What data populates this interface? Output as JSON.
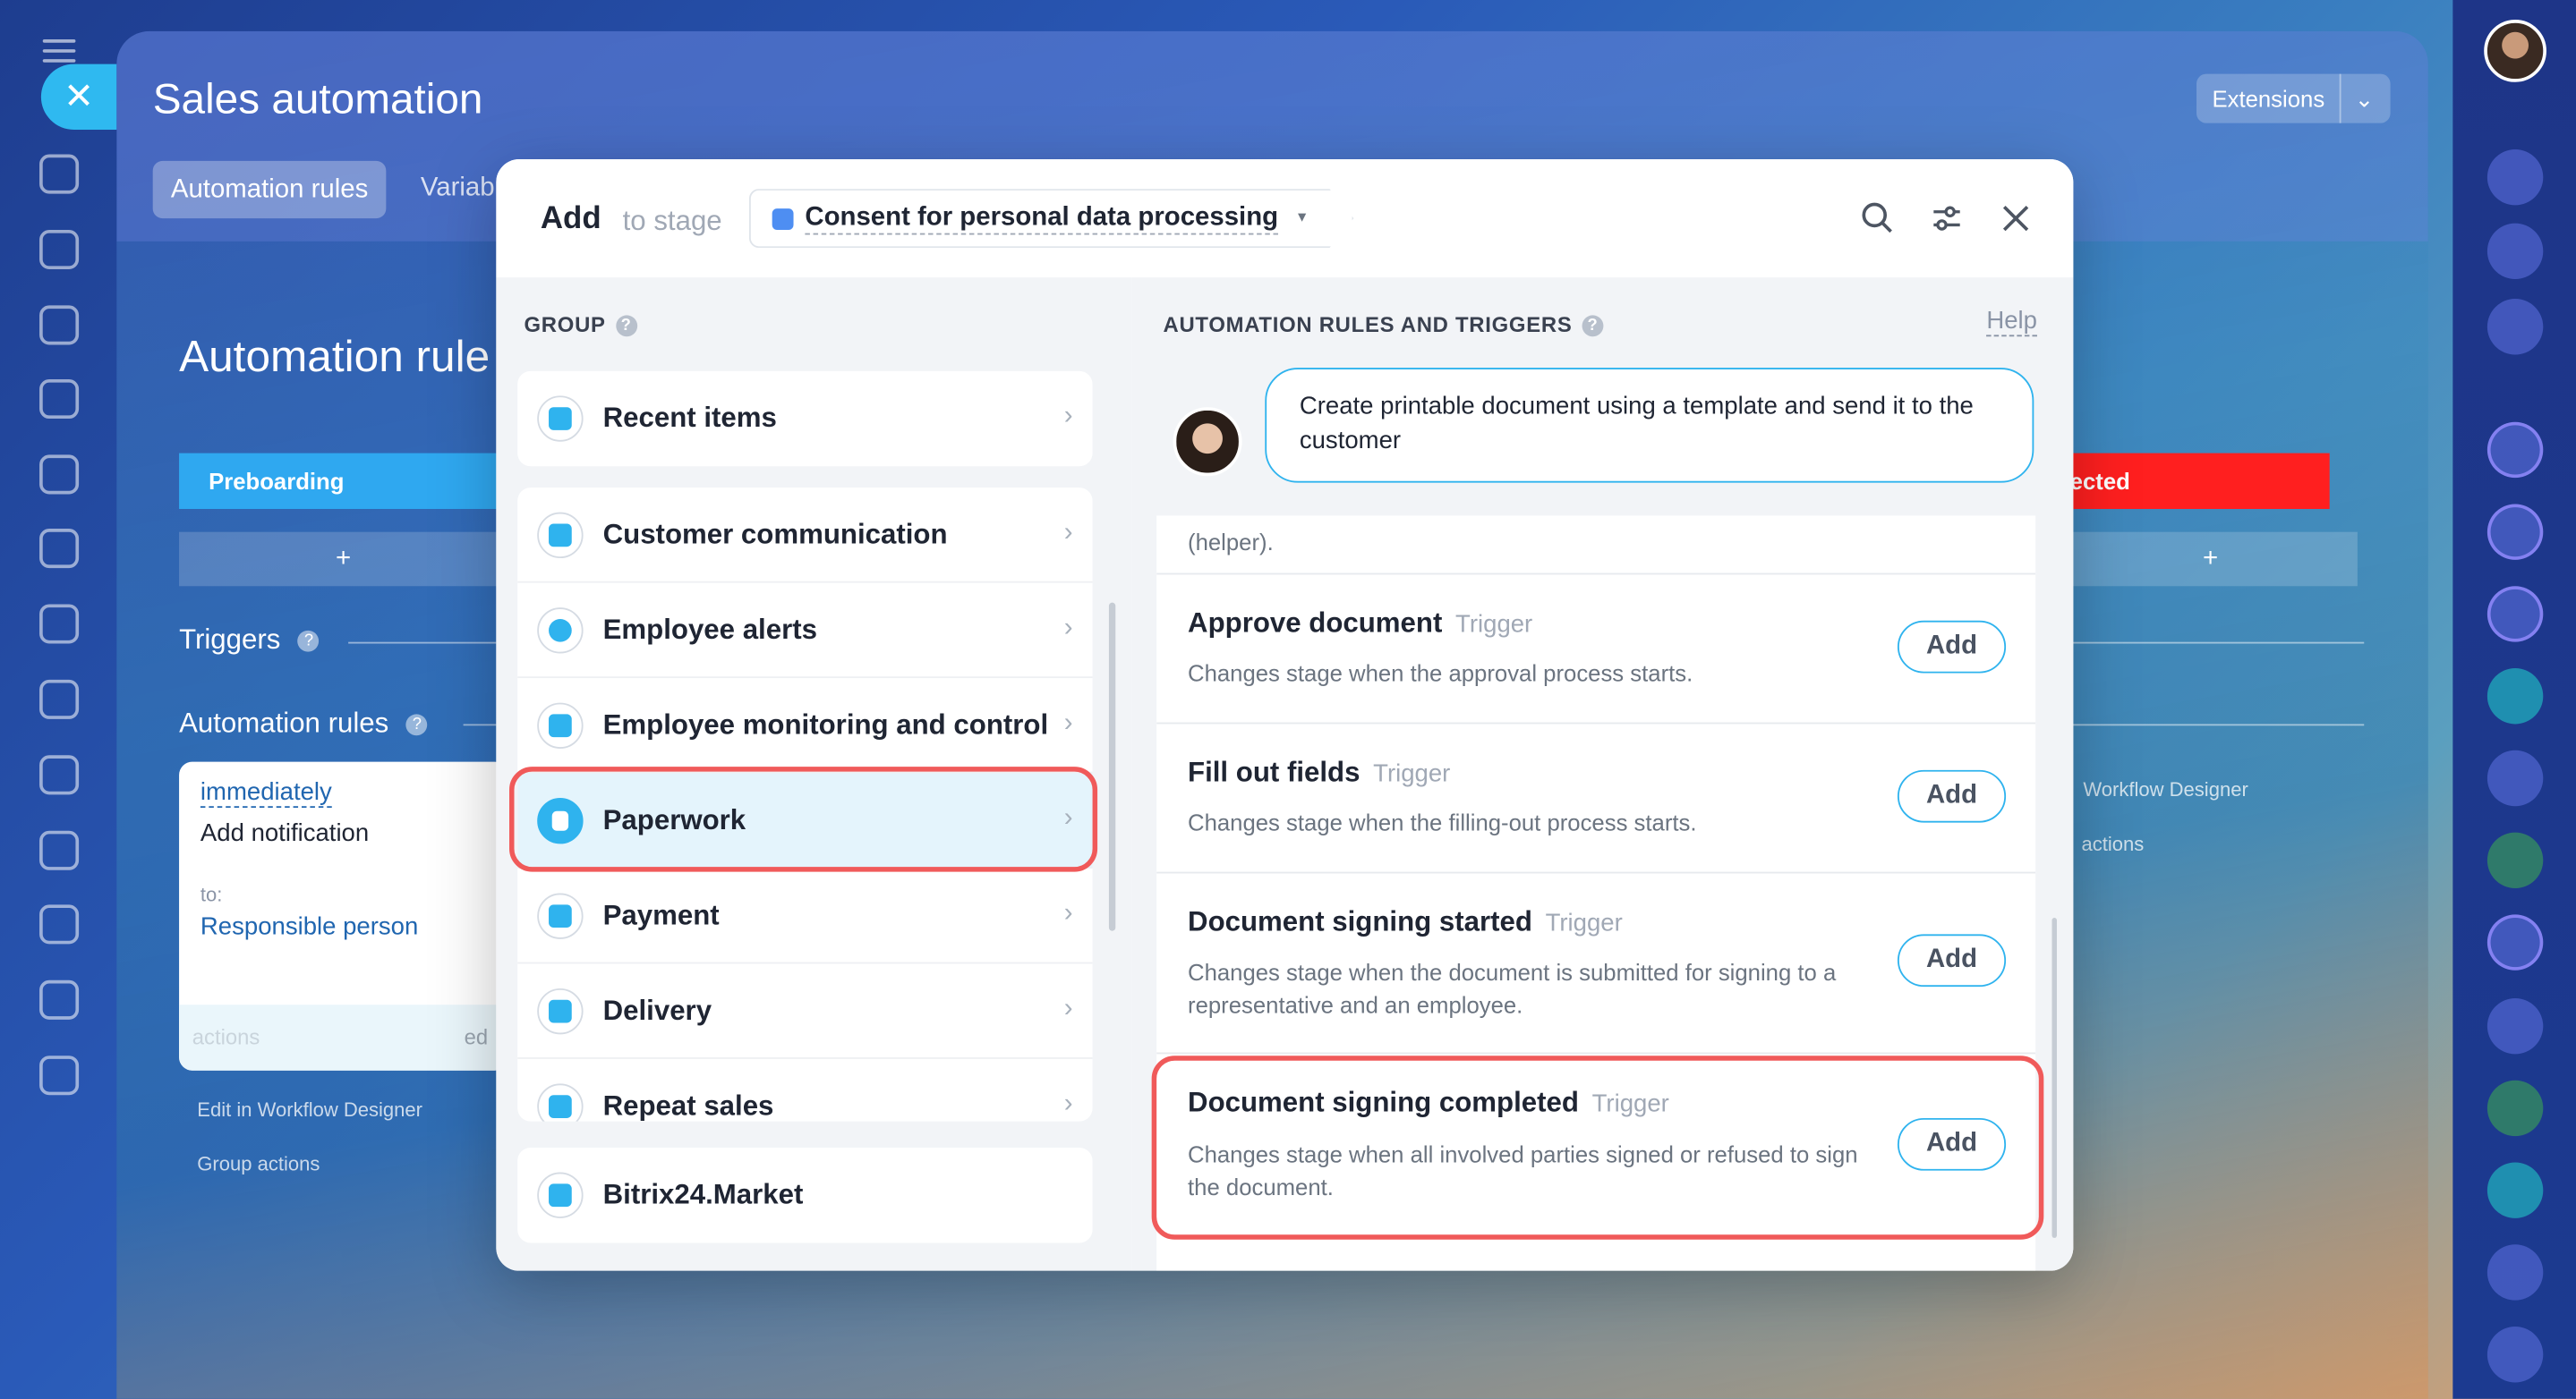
{
  "page": {
    "title": "Sales automation",
    "extensions_label": "Extensions",
    "tabs": [
      "Automation rules",
      "Variab"
    ],
    "section_title": "Automation rule",
    "stages": {
      "left": "Preboarding",
      "right": "ected",
      "plus": "+"
    },
    "triggers_label": "Triggers",
    "rules_label": "Automation rules",
    "rule_card": {
      "when": "immediately",
      "name": "Add notification",
      "to_label": "to:",
      "recipient": "Responsible person",
      "footer_left": "actions",
      "footer_right": "ed"
    },
    "links_left": [
      "Edit in Workflow Designer",
      "Group actions"
    ],
    "links_right": [
      "Workflow Designer",
      "actions"
    ]
  },
  "modal": {
    "add_label": "Add",
    "to_stage_label": "to stage",
    "stage_name": "Consent for personal data processing",
    "group_header": "GROUP",
    "rules_header": "AUTOMATION RULES AND TRIGGERS",
    "help_label": "Help",
    "groups_top": [
      {
        "label": "Recent items"
      }
    ],
    "groups_main": [
      {
        "label": "Customer communication"
      },
      {
        "label": "Employee alerts"
      },
      {
        "label": "Employee monitoring and control"
      },
      {
        "label": "Paperwork"
      },
      {
        "label": "Payment"
      },
      {
        "label": "Delivery"
      },
      {
        "label": "Repeat sales"
      }
    ],
    "groups_bottom": [
      {
        "label": "Bitrix24.Market"
      }
    ],
    "selected_group": "Paperwork",
    "tip_text": "Create printable document using a template and send it to the customer",
    "partial_text": "(helper).",
    "trigger_label": "Trigger",
    "add_button": "Add",
    "items": [
      {
        "title": "Approve document",
        "desc": "Changes stage when the approval process starts."
      },
      {
        "title": "Fill out fields",
        "desc": "Changes stage when the filling-out process starts."
      },
      {
        "title": "Document signing started",
        "desc": "Changes stage when the document is submitted for signing to a representative and an employee."
      },
      {
        "title": "Document signing completed",
        "desc": "Changes stage when all involved parties signed or refused to sign the document."
      }
    ]
  },
  "colors": {
    "accent": "#2fb3ee",
    "highlight": "#f05a5a",
    "reject_stage": "#ff1f1f",
    "preboarding_stage": "#2fa8f0"
  }
}
